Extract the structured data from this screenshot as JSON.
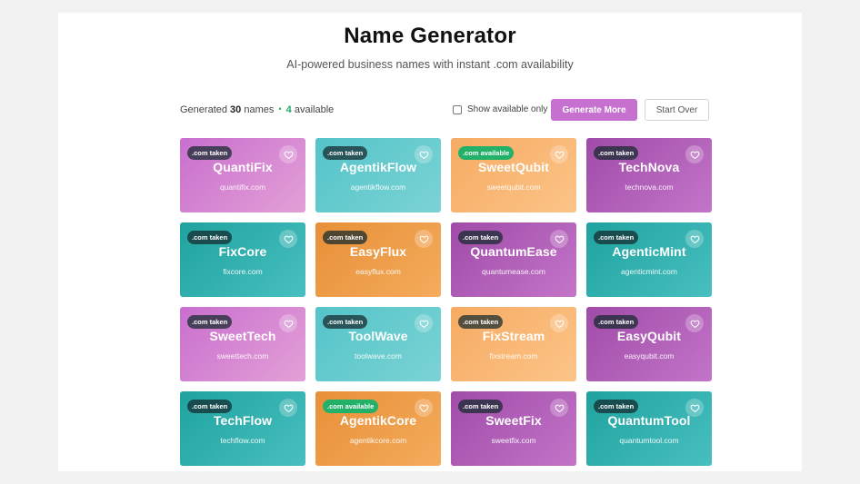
{
  "header": {
    "title": "Name Generator",
    "subtitle": "AI-powered business names with instant .com availability"
  },
  "status": {
    "prefix": "Generated",
    "count": "30",
    "names_word": "names",
    "dot": "•",
    "available_count": "4",
    "available_word": "available"
  },
  "controls": {
    "filter_label": "Show available only",
    "filter_checked": false,
    "generate_label": "Generate More",
    "start_over_label": "Start Over"
  },
  "colors": {
    "pink": "#c96fcf",
    "cyan": "#54c4c9",
    "peach": "#f6ab63",
    "purple": "#a04ba8",
    "teal": "#1fa39f",
    "orange": "#e88f38",
    "available_badge": "#23b069",
    "accent_button": "#c670d0"
  },
  "cards": [
    {
      "name": "QuantiFix",
      "domain": "quantifix.com",
      "badge": ".com taken",
      "status": "taken",
      "color": "pink"
    },
    {
      "name": "AgentikFlow",
      "domain": "agentikflow.com",
      "badge": ".com taken",
      "status": "taken",
      "color": "cyan"
    },
    {
      "name": "SweetQubit",
      "domain": "sweetqubit.com",
      "badge": ".com available",
      "status": "available",
      "color": "peach"
    },
    {
      "name": "TechNova",
      "domain": "technova.com",
      "badge": ".com taken",
      "status": "taken",
      "color": "purple"
    },
    {
      "name": "FixCore",
      "domain": "fixcore.com",
      "badge": ".com taken",
      "status": "taken",
      "color": "teal"
    },
    {
      "name": "EasyFlux",
      "domain": "easyflux.com",
      "badge": ".com taken",
      "status": "taken",
      "color": "orange"
    },
    {
      "name": "QuantumEase",
      "domain": "quantumease.com",
      "badge": ".com taken",
      "status": "taken",
      "color": "purple"
    },
    {
      "name": "AgenticMint",
      "domain": "agenticmint.com",
      "badge": ".com taken",
      "status": "taken",
      "color": "teal"
    },
    {
      "name": "SweetTech",
      "domain": "sweettech.com",
      "badge": ".com taken",
      "status": "taken",
      "color": "pink"
    },
    {
      "name": "ToolWave",
      "domain": "toolwave.com",
      "badge": ".com taken",
      "status": "taken",
      "color": "cyan"
    },
    {
      "name": "FixStream",
      "domain": "fixstream.com",
      "badge": ".com taken",
      "status": "taken",
      "color": "peach"
    },
    {
      "name": "EasyQubit",
      "domain": "easyqubit.com",
      "badge": ".com taken",
      "status": "taken",
      "color": "purple"
    },
    {
      "name": "TechFlow",
      "domain": "techflow.com",
      "badge": ".com taken",
      "status": "taken",
      "color": "teal"
    },
    {
      "name": "AgentikCore",
      "domain": "agentikcore.com",
      "badge": ".com available",
      "status": "available",
      "color": "orange"
    },
    {
      "name": "SweetFix",
      "domain": "sweetfix.com",
      "badge": ".com taken",
      "status": "taken",
      "color": "purple"
    },
    {
      "name": "QuantumTool",
      "domain": "quantumtool.com",
      "badge": ".com taken",
      "status": "taken",
      "color": "teal"
    }
  ],
  "icons": {
    "favorite": "heart-icon"
  }
}
